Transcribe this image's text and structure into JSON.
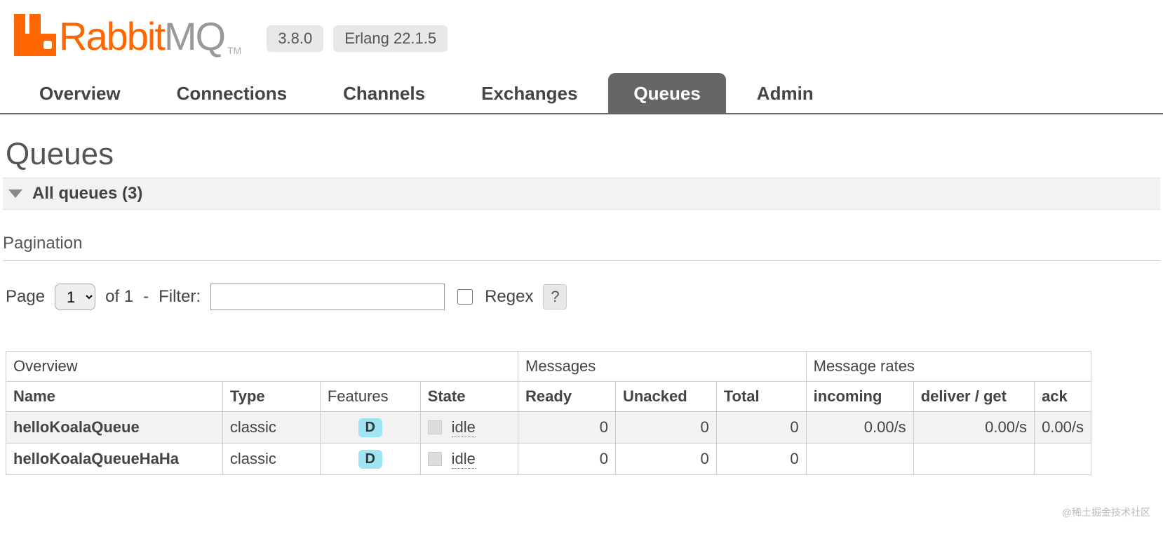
{
  "header": {
    "brand_first": "Rabbit",
    "brand_second": "MQ",
    "tm": "TM",
    "version": "3.8.0",
    "erlang": "Erlang 22.1.5"
  },
  "tabs": [
    {
      "id": "overview",
      "label": "Overview",
      "active": false
    },
    {
      "id": "connections",
      "label": "Connections",
      "active": false
    },
    {
      "id": "channels",
      "label": "Channels",
      "active": false
    },
    {
      "id": "exchanges",
      "label": "Exchanges",
      "active": false
    },
    {
      "id": "queues",
      "label": "Queues",
      "active": true
    },
    {
      "id": "admin",
      "label": "Admin",
      "active": false
    }
  ],
  "page": {
    "title": "Queues",
    "section_label": "All queues (3)",
    "pagination_heading": "Pagination",
    "pager": {
      "page_label": "Page",
      "page_value": "1",
      "of_label": "of 1",
      "dash": "-",
      "filter_label": "Filter:",
      "regex_label": "Regex",
      "help": "?"
    },
    "table": {
      "groups": {
        "overview": "Overview",
        "messages": "Messages",
        "rates": "Message rates"
      },
      "cols": {
        "name": "Name",
        "type": "Type",
        "features": "Features",
        "state": "State",
        "ready": "Ready",
        "unacked": "Unacked",
        "total": "Total",
        "incoming": "incoming",
        "deliver": "deliver / get",
        "ack": "ack"
      },
      "rows": [
        {
          "name": "helloKoalaQueue",
          "type": "classic",
          "feature": "D",
          "state": "idle",
          "ready": "0",
          "unacked": "0",
          "total": "0",
          "incoming": "0.00/s",
          "deliver": "0.00/s",
          "ack": "0.00/s"
        },
        {
          "name": "helloKoalaQueueHaHa",
          "type": "classic",
          "feature": "D",
          "state": "idle",
          "ready": "0",
          "unacked": "0",
          "total": "0",
          "incoming": "",
          "deliver": "",
          "ack": ""
        }
      ]
    }
  },
  "watermark": "@稀土掘金技术社区"
}
